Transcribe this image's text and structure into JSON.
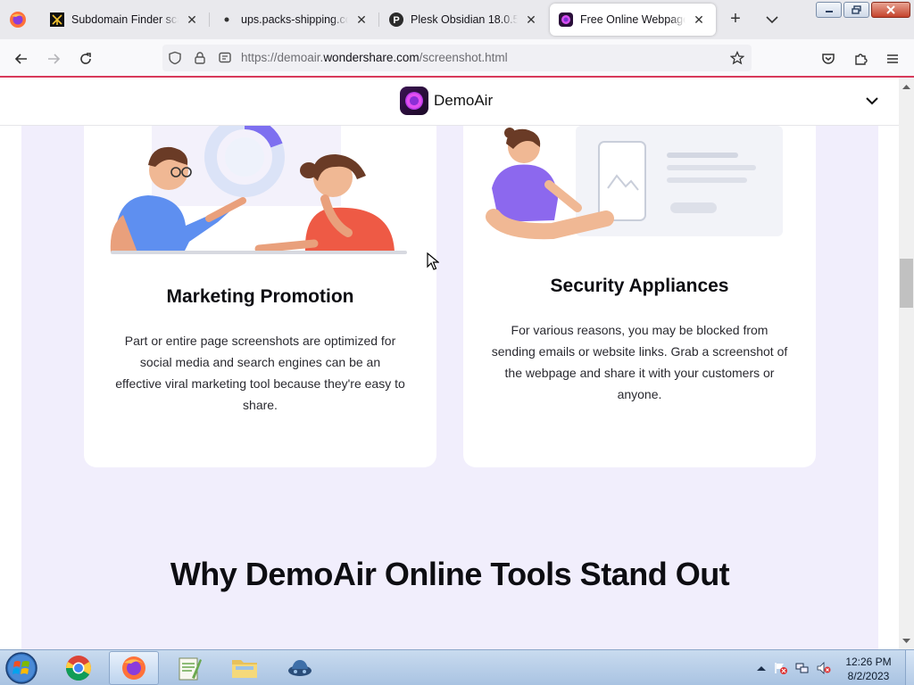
{
  "tabs": [
    {
      "title": "Subdomain Finder scan c",
      "close": "✕",
      "active": false
    },
    {
      "title": "ups.packs-shipping.com/",
      "close": "✕",
      "active": false
    },
    {
      "title": "Plesk Obsidian 18.0.53",
      "close": "✕",
      "active": false
    },
    {
      "title": "Free Online Webpage Sc",
      "close": "✕",
      "active": true
    }
  ],
  "newtab_label": "+",
  "url": {
    "prefix": "https://demoair.",
    "domain": "wondershare.com",
    "path": "/screenshot.html"
  },
  "site": {
    "brand": "DemoAir"
  },
  "cards": [
    {
      "title": "Marketing Promotion",
      "body": "Part or entire page screenshots are optimized for social media and search engines can be an effective viral marketing tool because they're easy to share."
    },
    {
      "title": "Security Appliances",
      "body": "For various reasons, you may be blocked from sending emails or website links. Grab a screenshot of the webpage and share it with your customers or anyone."
    }
  ],
  "section_heading": "Why DemoAir Online Tools Stand Out",
  "taskbar": {
    "time": "12:26 PM",
    "date": "8/2/2023"
  },
  "colors": {
    "accent_line": "#d83a5a",
    "band": "#f1eefc",
    "brand_purple": "#b63be6"
  }
}
